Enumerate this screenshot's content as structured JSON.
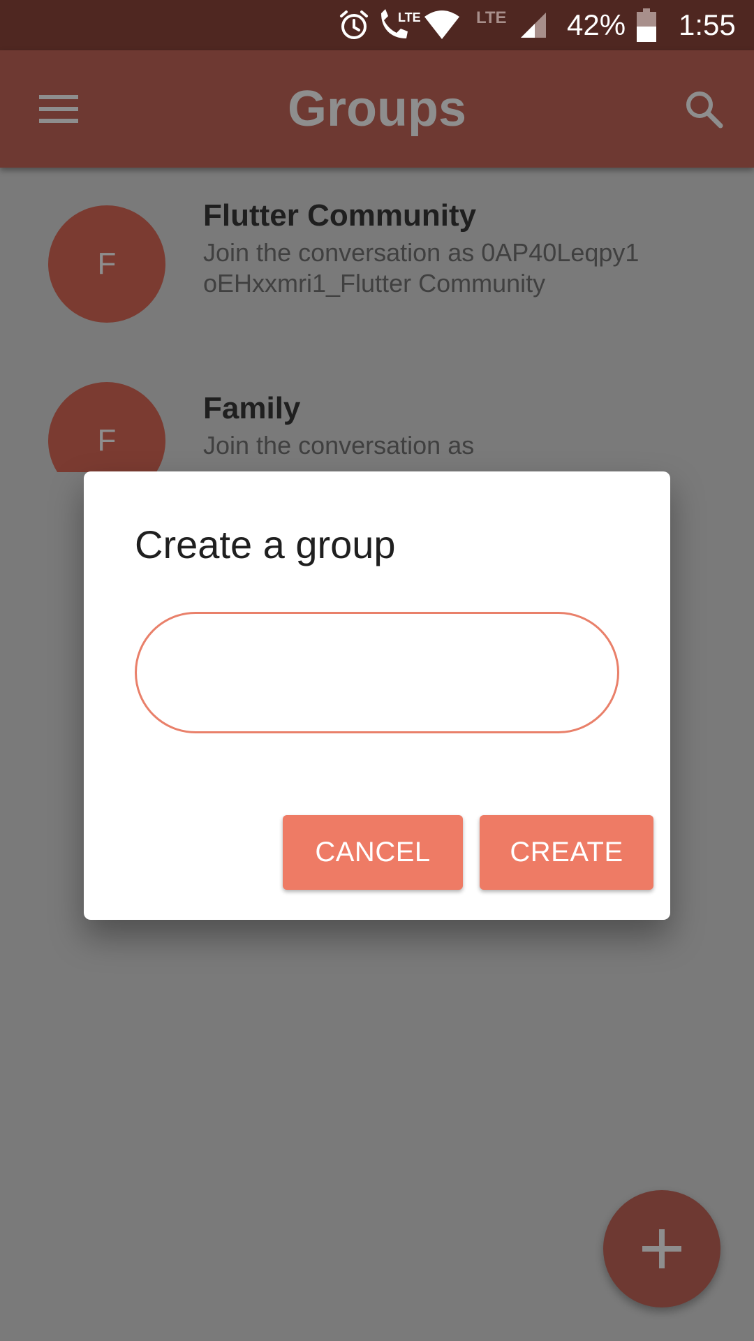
{
  "status_bar": {
    "battery_percent": "42%",
    "time": "1:55",
    "icons": [
      "alarm-icon",
      "volte-call-icon",
      "wifi-icon",
      "lte-signal-icon",
      "battery-icon"
    ],
    "lte_label": "LTE"
  },
  "app_bar": {
    "title": "Groups",
    "menu_icon": "hamburger-menu-icon",
    "search_icon": "search-icon"
  },
  "groups": [
    {
      "avatar_letter": "F",
      "name": "Flutter Community",
      "description": "Join the conversation as 0AP40Leqpy1oEHxxmri1_Flutter Community"
    },
    {
      "avatar_letter": "F",
      "name": "Family",
      "description": "Join the conversation as"
    }
  ],
  "dialog": {
    "title": "Create a group",
    "input_value": "",
    "input_placeholder": "",
    "cancel_label": "CANCEL",
    "create_label": "CREATE"
  },
  "fab": {
    "icon": "add-icon"
  },
  "colors": {
    "status_bar_bg": "#4f2721",
    "app_bar_bg": "#6e3932",
    "accent": "#ee7b65",
    "scrim_bg": "#7a7a7a"
  }
}
